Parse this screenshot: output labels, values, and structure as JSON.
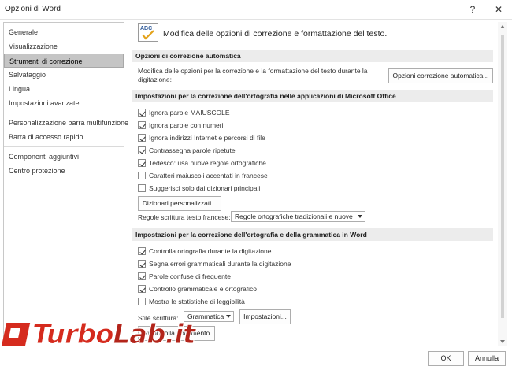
{
  "window": {
    "title": "Opzioni di Word",
    "help_glyph": "?",
    "close_glyph": "✕"
  },
  "sidebar": {
    "items": [
      {
        "label": "Generale"
      },
      {
        "label": "Visualizzazione"
      },
      {
        "label": "Strumenti di correzione",
        "selected": true
      },
      {
        "label": "Salvataggio"
      },
      {
        "label": "Lingua"
      },
      {
        "label": "Impostazioni avanzate"
      },
      {
        "label": "Personalizzazione barra multifunzione"
      },
      {
        "label": "Barra di accesso rapido"
      },
      {
        "label": "Componenti aggiuntivi"
      },
      {
        "label": "Centro protezione"
      }
    ]
  },
  "header": {
    "icon": "abc-check-icon",
    "text": "Modifica delle opzioni di correzione e formattazione del testo."
  },
  "autocorrect": {
    "heading": "Opzioni di correzione automatica",
    "description": "Modifica delle opzioni per la correzione e la formattazione del testo durante la digitazione:",
    "button": "Opzioni correzione automatica..."
  },
  "office_spelling": {
    "heading": "Impostazioni per la correzione dell'ortografia nelle applicazioni di Microsoft Office",
    "options": [
      {
        "label": "Ignora parole MAIUSCOLE",
        "checked": true
      },
      {
        "label": "Ignora parole con numeri",
        "checked": true
      },
      {
        "label": "Ignora indirizzi Internet e percorsi di file",
        "checked": true
      },
      {
        "label": "Contrassegna parole ripetute",
        "checked": true
      },
      {
        "label": "Tedesco: usa nuove regole ortografiche",
        "checked": true
      },
      {
        "label": "Caratteri maiuscoli accentati in francese",
        "checked": false
      },
      {
        "label": "Suggerisci solo dai dizionari principali",
        "checked": false
      }
    ],
    "custom_dict_button": "Dizionari personalizzati...",
    "french_rules_label": "Regole scrittura testo francese:",
    "french_rules_value": "Regole ortografiche tradizionali e nuove"
  },
  "word_spelling": {
    "heading": "Impostazioni per la correzione dell'ortografia e della grammatica in Word",
    "options": [
      {
        "label": "Controlla ortografia durante la digitazione",
        "checked": true
      },
      {
        "label": "Segna errori grammaticali durante la digitazione",
        "checked": true
      },
      {
        "label": "Parole confuse di frequente",
        "checked": true
      },
      {
        "label": "Controllo grammaticale e ortografico",
        "checked": true
      },
      {
        "label": "Mostra le statistiche di leggibilità",
        "checked": false
      }
    ],
    "style_label": "Stile scrittura:",
    "style_value": "Grammatica",
    "settings_button": "Impostazioni...",
    "recheck_button": "Ricontrolla documento"
  },
  "footer": {
    "ok": "OK",
    "cancel": "Annulla"
  },
  "watermark": {
    "part1": "Turbo",
    "part2": "Lab.it"
  },
  "colors": {
    "selected_nav": "#c5c5c5",
    "section_bg": "#ececec",
    "watermark_red": "#d52b1e"
  }
}
